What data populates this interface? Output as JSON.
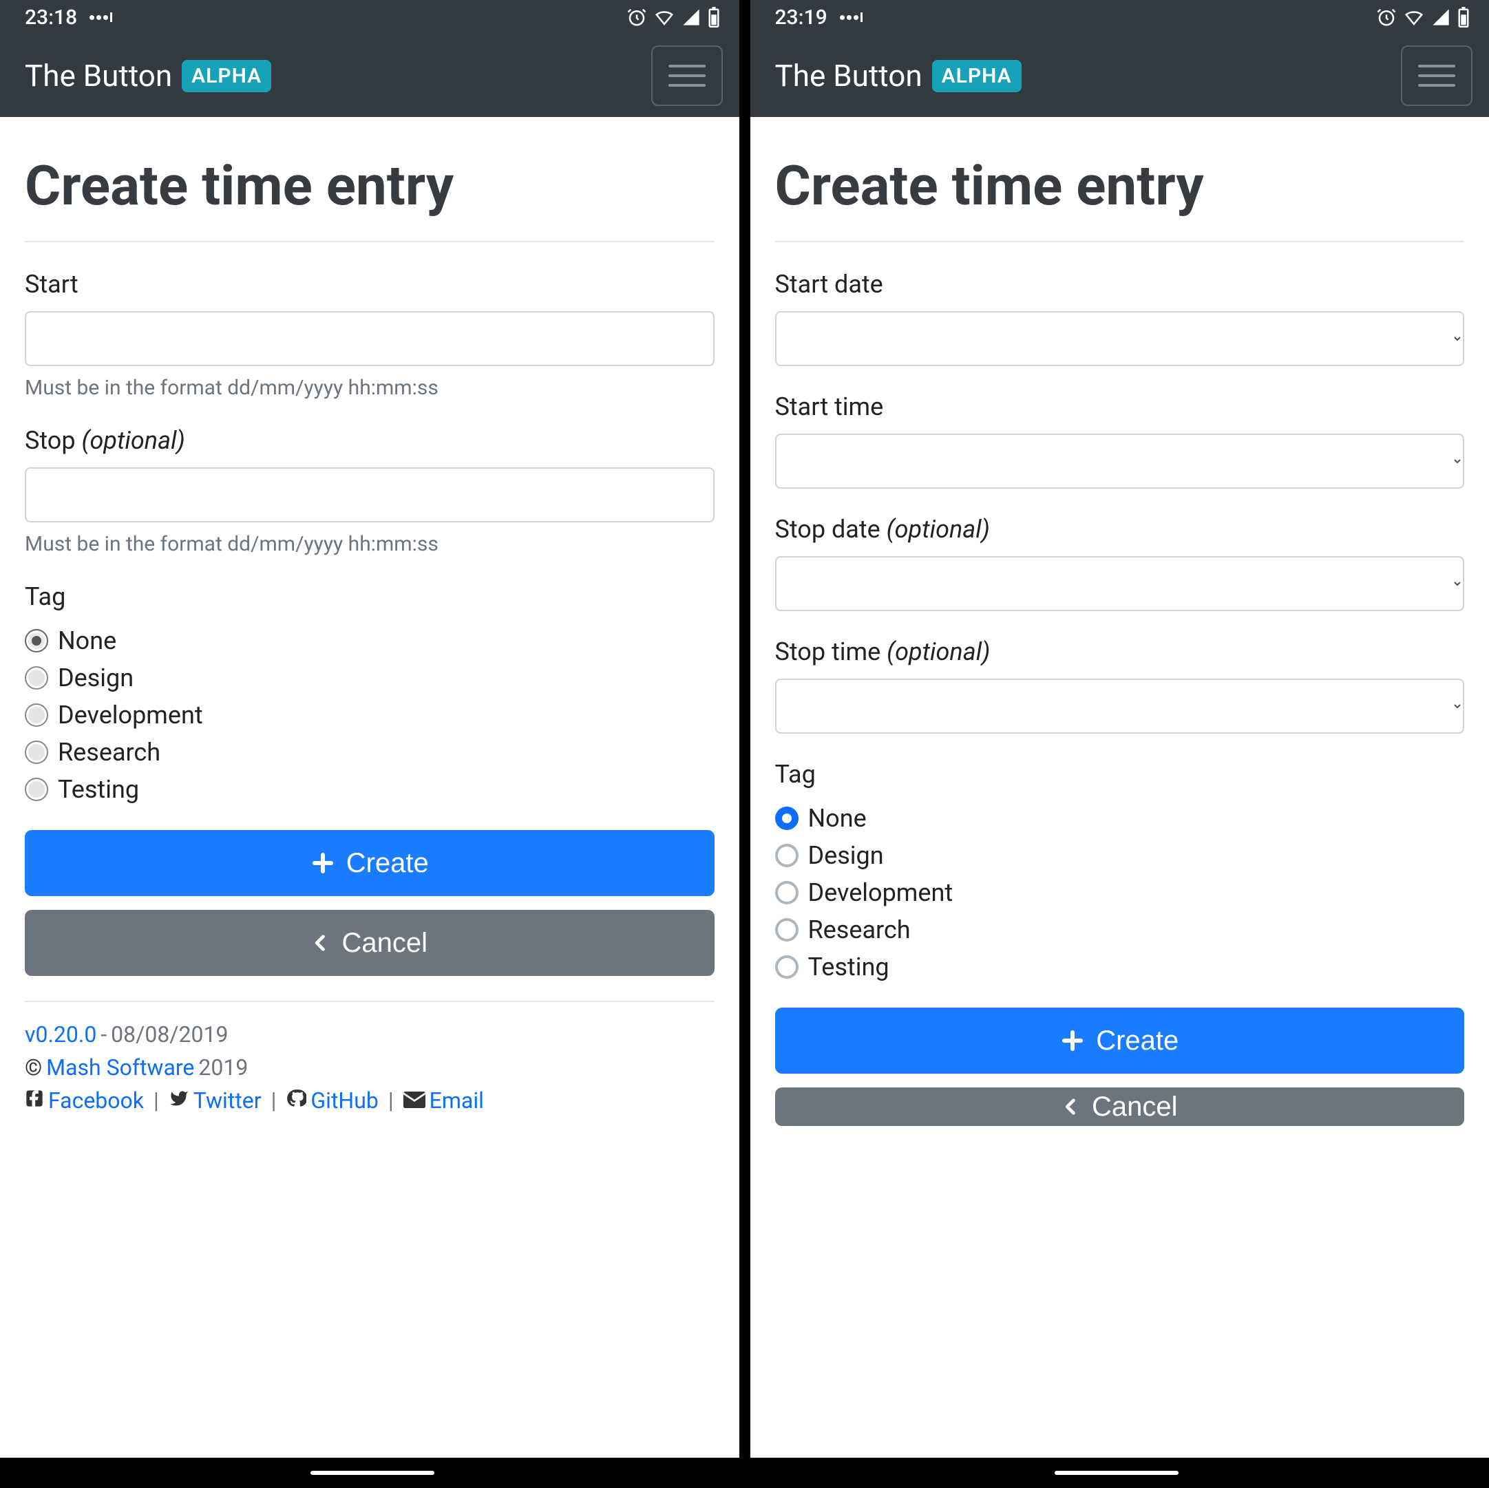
{
  "left": {
    "status": {
      "time": "23:18"
    },
    "navbar": {
      "brand": "The Button",
      "badge": "ALPHA"
    },
    "title": "Create time entry",
    "fields": {
      "start": {
        "label": "Start",
        "hint": "Must be in the format dd/mm/yyyy hh:mm:ss",
        "value": ""
      },
      "stop": {
        "label": "Stop",
        "optional": "(optional)",
        "hint": "Must be in the format dd/mm/yyyy hh:mm:ss",
        "value": ""
      }
    },
    "tag": {
      "label": "Tag",
      "options": [
        {
          "label": "None",
          "selected": true
        },
        {
          "label": "Design",
          "selected": false
        },
        {
          "label": "Development",
          "selected": false
        },
        {
          "label": "Research",
          "selected": false
        },
        {
          "label": "Testing",
          "selected": false
        }
      ]
    },
    "buttons": {
      "create": "Create",
      "cancel": "Cancel"
    },
    "footer": {
      "version": "v0.20.0",
      "date": "08/08/2019",
      "company": "Mash Software",
      "year": "2019",
      "links": {
        "facebook": "Facebook",
        "twitter": "Twitter",
        "github": "GitHub",
        "email": "Email"
      }
    }
  },
  "right": {
    "status": {
      "time": "23:19"
    },
    "navbar": {
      "brand": "The Button",
      "badge": "ALPHA"
    },
    "title": "Create time entry",
    "fields": {
      "start_date": {
        "label": "Start date"
      },
      "start_time": {
        "label": "Start time"
      },
      "stop_date": {
        "label": "Stop date",
        "optional": "(optional)"
      },
      "stop_time": {
        "label": "Stop time",
        "optional": "(optional)"
      }
    },
    "tag": {
      "label": "Tag",
      "options": [
        {
          "label": "None",
          "selected": true
        },
        {
          "label": "Design",
          "selected": false
        },
        {
          "label": "Development",
          "selected": false
        },
        {
          "label": "Research",
          "selected": false
        },
        {
          "label": "Testing",
          "selected": false
        }
      ]
    },
    "buttons": {
      "create": "Create",
      "cancel": "Cancel"
    }
  }
}
